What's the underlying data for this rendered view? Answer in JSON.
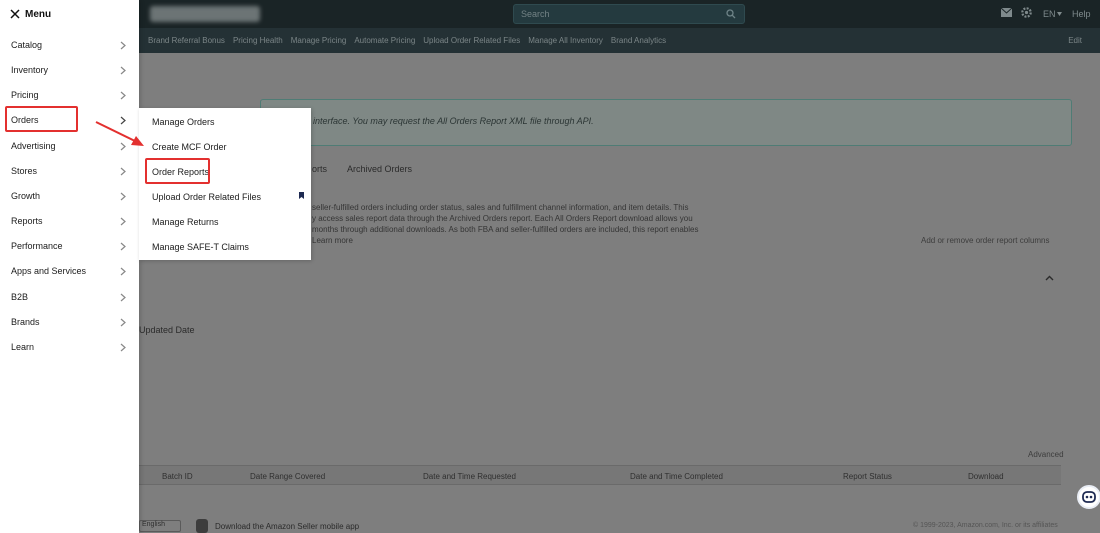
{
  "topbar": {
    "search_placeholder": "Search",
    "language": "EN",
    "help": "Help"
  },
  "navbar": {
    "items": [
      "Brand Referral Bonus",
      "Pricing Health",
      "Manage Pricing",
      "Automate Pricing",
      "Upload Order Related Files",
      "Manage All Inventory",
      "Brand Analytics"
    ],
    "edit": "Edit"
  },
  "background": {
    "banner_text": "interface. You may request the All Orders Report XML file through API.",
    "tabs": [
      "orts",
      "Archived Orders"
    ],
    "para_lines": [
      "seller-fulfilled orders including order status, sales and fulfillment channel information, and item details. This",
      "y access sales report data through the Archived Orders report. Each All Orders Report download allows you",
      "months through additional downloads. As both FBA and seller-fulfilled orders are included, this report enables",
      "Learn more"
    ],
    "right_link": "Add or remove order report columns",
    "updated_label": "Updated Date",
    "advanced_search": "Advanced",
    "table_headers": [
      "Batch ID",
      "Date Range Covered",
      "Date and Time Requested",
      "Date and Time Completed",
      "Report Status",
      "Download"
    ],
    "footer_select": "English",
    "footer_app_text": "Download the Amazon Seller mobile app",
    "footer_copyright": "© 1999-2023, Amazon.com, Inc. or its affiliates"
  },
  "menu": {
    "title": "Menu",
    "items": [
      "Catalog",
      "Inventory",
      "Pricing",
      "Orders",
      "Advertising",
      "Stores",
      "Growth",
      "Reports",
      "Performance",
      "Apps and Services",
      "B2B",
      "Brands",
      "Learn"
    ]
  },
  "submenu": {
    "items": [
      "Manage Orders",
      "Create MCF Order",
      "Order Reports",
      "Upload Order Related Files",
      "Manage Returns",
      "Manage SAFE-T Claims"
    ]
  },
  "colors": {
    "highlight": "#e3302f",
    "topbar": "#1a2426",
    "navbar": "#243135"
  }
}
